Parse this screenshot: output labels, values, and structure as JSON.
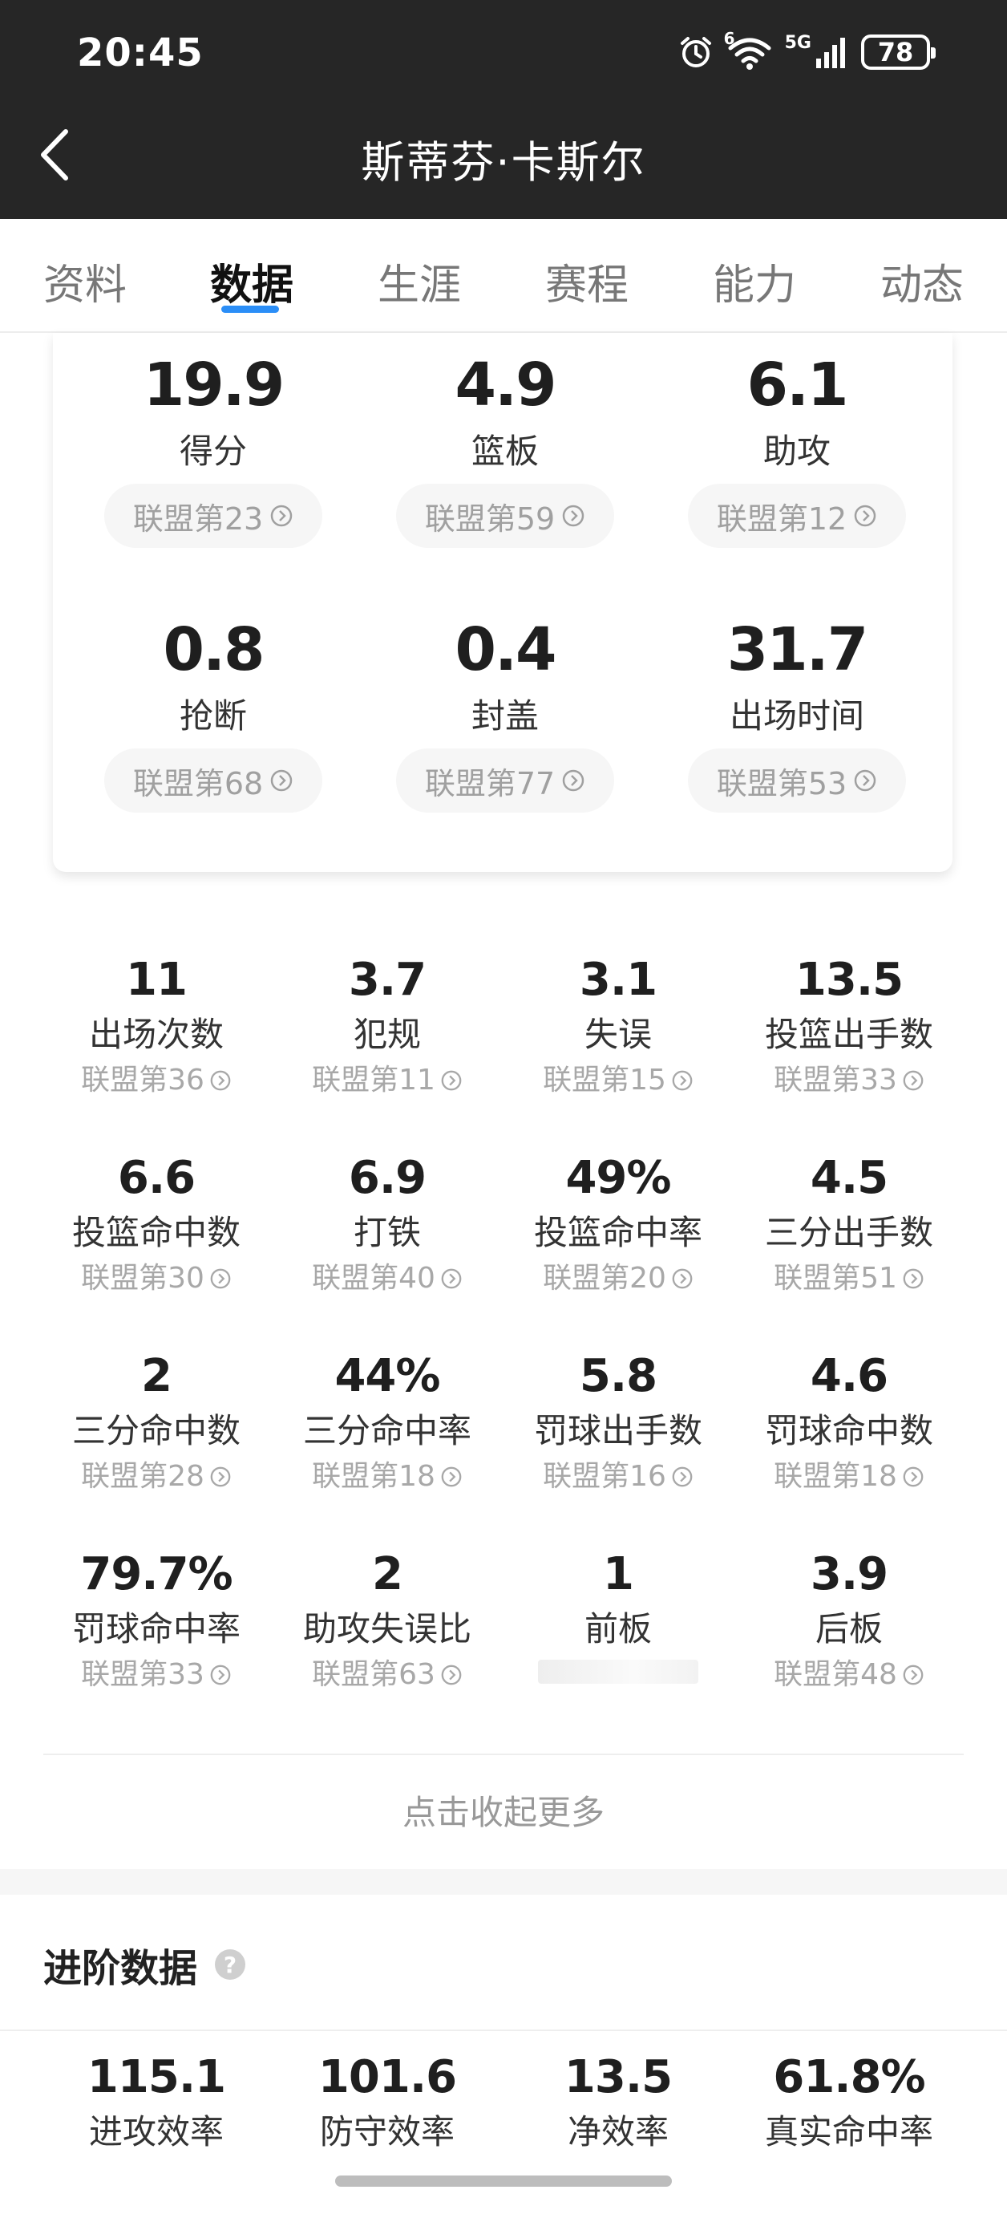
{
  "status_bar": {
    "time": "20:45",
    "battery": "78",
    "network": "5G",
    "wifi_badge": "6"
  },
  "header": {
    "title": "斯蒂芬·卡斯尔"
  },
  "tabs": [
    {
      "label": "资料"
    },
    {
      "label": "数据"
    },
    {
      "label": "生涯"
    },
    {
      "label": "赛程"
    },
    {
      "label": "能力"
    },
    {
      "label": "动态"
    }
  ],
  "active_tab": "数据",
  "summary": [
    {
      "value": "19.9",
      "label": "得分",
      "rank": "联盟第23"
    },
    {
      "value": "4.9",
      "label": "篮板",
      "rank": "联盟第59"
    },
    {
      "value": "6.1",
      "label": "助攻",
      "rank": "联盟第12"
    },
    {
      "value": "0.8",
      "label": "抢断",
      "rank": "联盟第68"
    },
    {
      "value": "0.4",
      "label": "封盖",
      "rank": "联盟第77"
    },
    {
      "value": "31.7",
      "label": "出场时间",
      "rank": "联盟第53"
    }
  ],
  "stats": [
    {
      "value": "11",
      "label": "出场次数",
      "rank": "联盟第36"
    },
    {
      "value": "3.7",
      "label": "犯规",
      "rank": "联盟第11"
    },
    {
      "value": "3.1",
      "label": "失误",
      "rank": "联盟第15"
    },
    {
      "value": "13.5",
      "label": "投篮出手数",
      "rank": "联盟第33"
    },
    {
      "value": "6.6",
      "label": "投篮命中数",
      "rank": "联盟第30"
    },
    {
      "value": "6.9",
      "label": "打铁",
      "rank": "联盟第40"
    },
    {
      "value": "49%",
      "label": "投篮命中率",
      "rank": "联盟第20"
    },
    {
      "value": "4.5",
      "label": "三分出手数",
      "rank": "联盟第51"
    },
    {
      "value": "2",
      "label": "三分命中数",
      "rank": "联盟第28"
    },
    {
      "value": "44%",
      "label": "三分命中率",
      "rank": "联盟第18"
    },
    {
      "value": "5.8",
      "label": "罚球出手数",
      "rank": "联盟第16"
    },
    {
      "value": "4.6",
      "label": "罚球命中数",
      "rank": "联盟第18"
    },
    {
      "value": "79.7%",
      "label": "罚球命中率",
      "rank": "联盟第33"
    },
    {
      "value": "2",
      "label": "助攻失误比",
      "rank": "联盟第63"
    },
    {
      "value": "1",
      "label": "前板",
      "rank": ""
    },
    {
      "value": "3.9",
      "label": "后板",
      "rank": "联盟第48"
    }
  ],
  "collapse_label": "点击收起更多",
  "advanced": {
    "title": "进阶数据",
    "help_icon": "?",
    "items": [
      {
        "value": "115.1",
        "label": "进攻效率"
      },
      {
        "value": "101.6",
        "label": "防守效率"
      },
      {
        "value": "13.5",
        "label": "净效率"
      },
      {
        "value": "61.8%",
        "label": "真实命中率"
      }
    ]
  },
  "colors": {
    "header_bg": "#262626",
    "tab_indicator": "#2b8ef7"
  }
}
